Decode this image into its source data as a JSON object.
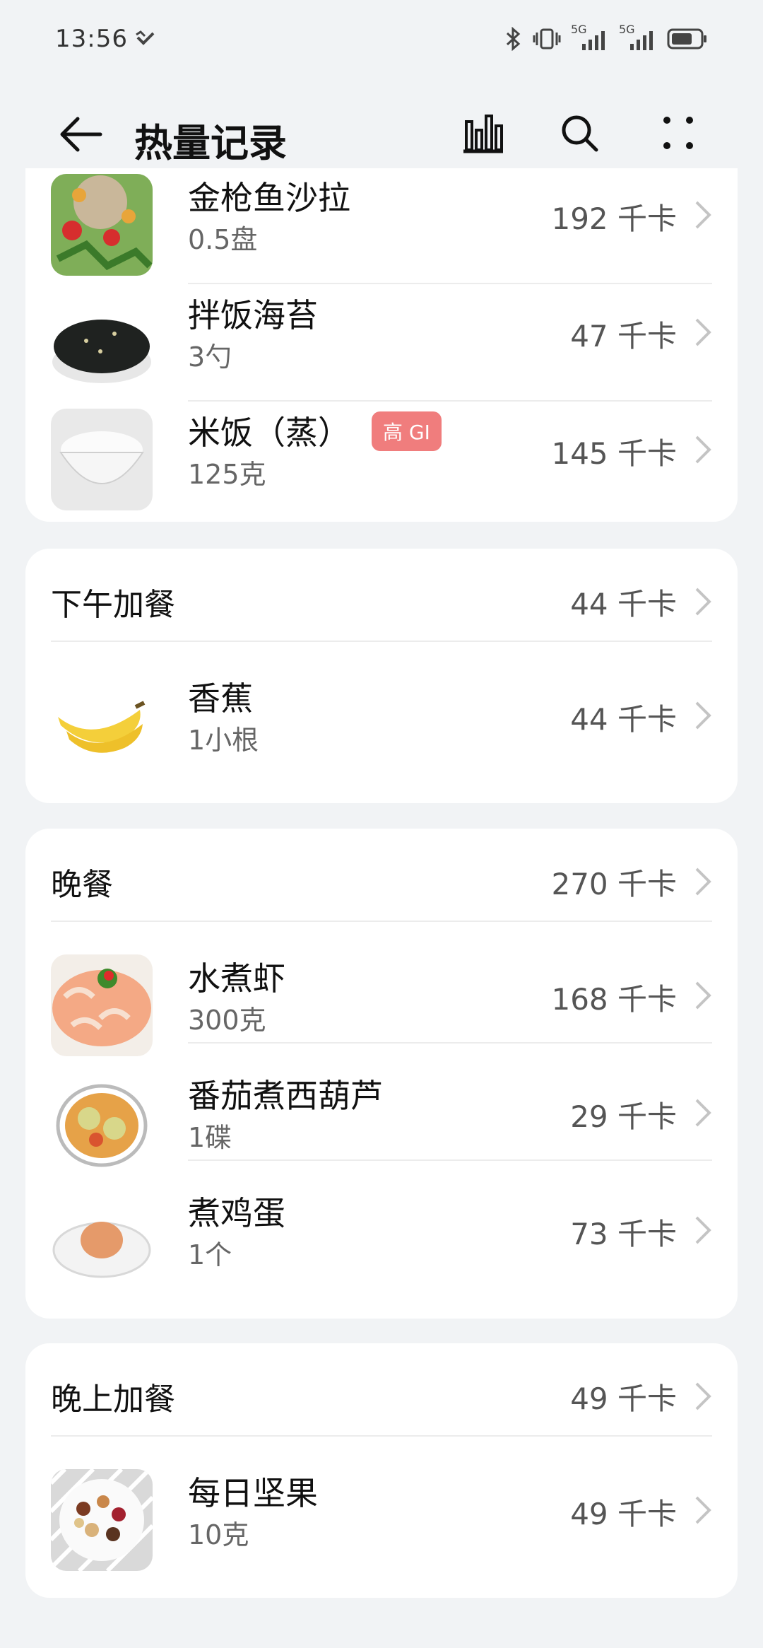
{
  "status": {
    "time": "13:56",
    "net1": "5G",
    "net2": "5G"
  },
  "header": {
    "title": "热量记录"
  },
  "lunch_items": [
    {
      "name": "金枪鱼沙拉",
      "qty": "0.5盘",
      "kcal": "192 千卡"
    },
    {
      "name": "拌饭海苔",
      "qty": "3勺",
      "kcal": "47 千卡"
    },
    {
      "name": "米饭（蒸）",
      "qty": "125克",
      "kcal": "145 千卡",
      "badge": "高 GI"
    }
  ],
  "afternoon_snack": {
    "title": "下午加餐",
    "kcal": "44 千卡",
    "items": [
      {
        "name": "香蕉",
        "qty": "1小根",
        "kcal": "44 千卡"
      }
    ]
  },
  "dinner": {
    "title": "晚餐",
    "kcal": "270 千卡",
    "items": [
      {
        "name": "水煮虾",
        "qty": "300克",
        "kcal": "168 千卡"
      },
      {
        "name": "番茄煮西葫芦",
        "qty": "1碟",
        "kcal": "29 千卡"
      },
      {
        "name": "煮鸡蛋",
        "qty": "1个",
        "kcal": "73 千卡"
      }
    ]
  },
  "evening_snack": {
    "title": "晚上加餐",
    "kcal": "49 千卡",
    "items": [
      {
        "name": "每日坚果",
        "qty": "10克",
        "kcal": "49 千卡"
      }
    ]
  },
  "icons": [
    "back-arrow-icon",
    "bar-chart-icon",
    "search-icon",
    "more-icon",
    "chevron-right-icon",
    "bluetooth-icon",
    "vibrate-icon",
    "signal-icon",
    "battery-icon"
  ]
}
